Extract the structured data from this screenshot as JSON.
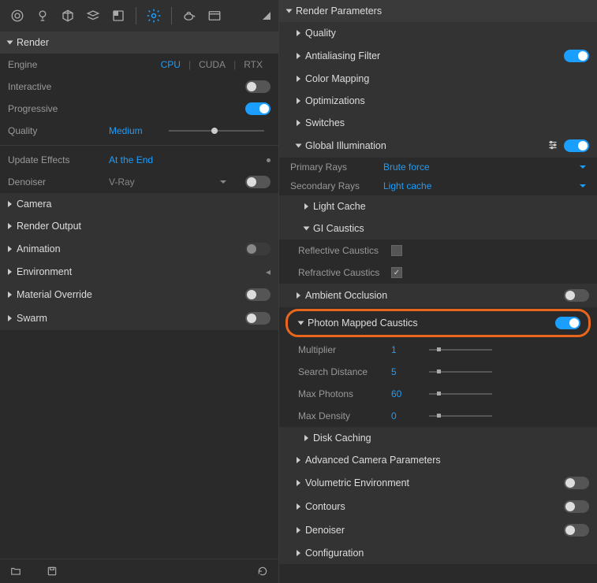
{
  "leftPanel": {
    "renderHeader": "Render",
    "engine": {
      "label": "Engine",
      "options": [
        "CPU",
        "CUDA",
        "RTX"
      ],
      "active": "CPU"
    },
    "interactive": {
      "label": "Interactive",
      "on": false
    },
    "progressive": {
      "label": "Progressive",
      "on": true
    },
    "quality": {
      "label": "Quality",
      "value": "Medium"
    },
    "updateEffects": {
      "label": "Update Effects",
      "value": "At the End"
    },
    "denoiser": {
      "label": "Denoiser",
      "value": "V-Ray",
      "on": false
    },
    "sections": {
      "camera": "Camera",
      "renderOutput": "Render Output",
      "animation": "Animation",
      "environment": "Environment",
      "materialOverride": "Material Override",
      "swarm": "Swarm"
    },
    "toggles": {
      "animation": false,
      "materialOverride": false,
      "swarm": false
    }
  },
  "rightPanel": {
    "renderParams": "Render Parameters",
    "quality": "Quality",
    "antialiasing": {
      "label": "Antialiasing Filter",
      "on": true
    },
    "colorMapping": "Color Mapping",
    "optimizations": "Optimizations",
    "switches": "Switches",
    "gi": {
      "label": "Global Illumination",
      "on": true
    },
    "primaryRays": {
      "label": "Primary Rays",
      "value": "Brute force"
    },
    "secondaryRays": {
      "label": "Secondary Rays",
      "value": "Light cache"
    },
    "lightCache": "Light Cache",
    "giCaustics": "GI Caustics",
    "reflective": {
      "label": "Reflective Caustics",
      "checked": false
    },
    "refractive": {
      "label": "Refractive Caustics",
      "checked": true
    },
    "ambientOcclusion": {
      "label": "Ambient Occlusion",
      "on": false
    },
    "photonCaustics": {
      "label": "Photon Mapped Caustics",
      "on": true
    },
    "multiplier": {
      "label": "Multiplier",
      "value": "1"
    },
    "searchDistance": {
      "label": "Search Distance",
      "value": "5"
    },
    "maxPhotons": {
      "label": "Max Photons",
      "value": "60"
    },
    "maxDensity": {
      "label": "Max Density",
      "value": "0"
    },
    "diskCaching": "Disk Caching",
    "advCamera": "Advanced Camera Parameters",
    "volEnv": {
      "label": "Volumetric Environment",
      "on": false
    },
    "contours": {
      "label": "Contours",
      "on": false
    },
    "denoiser": {
      "label": "Denoiser",
      "on": false
    },
    "configuration": "Configuration"
  }
}
